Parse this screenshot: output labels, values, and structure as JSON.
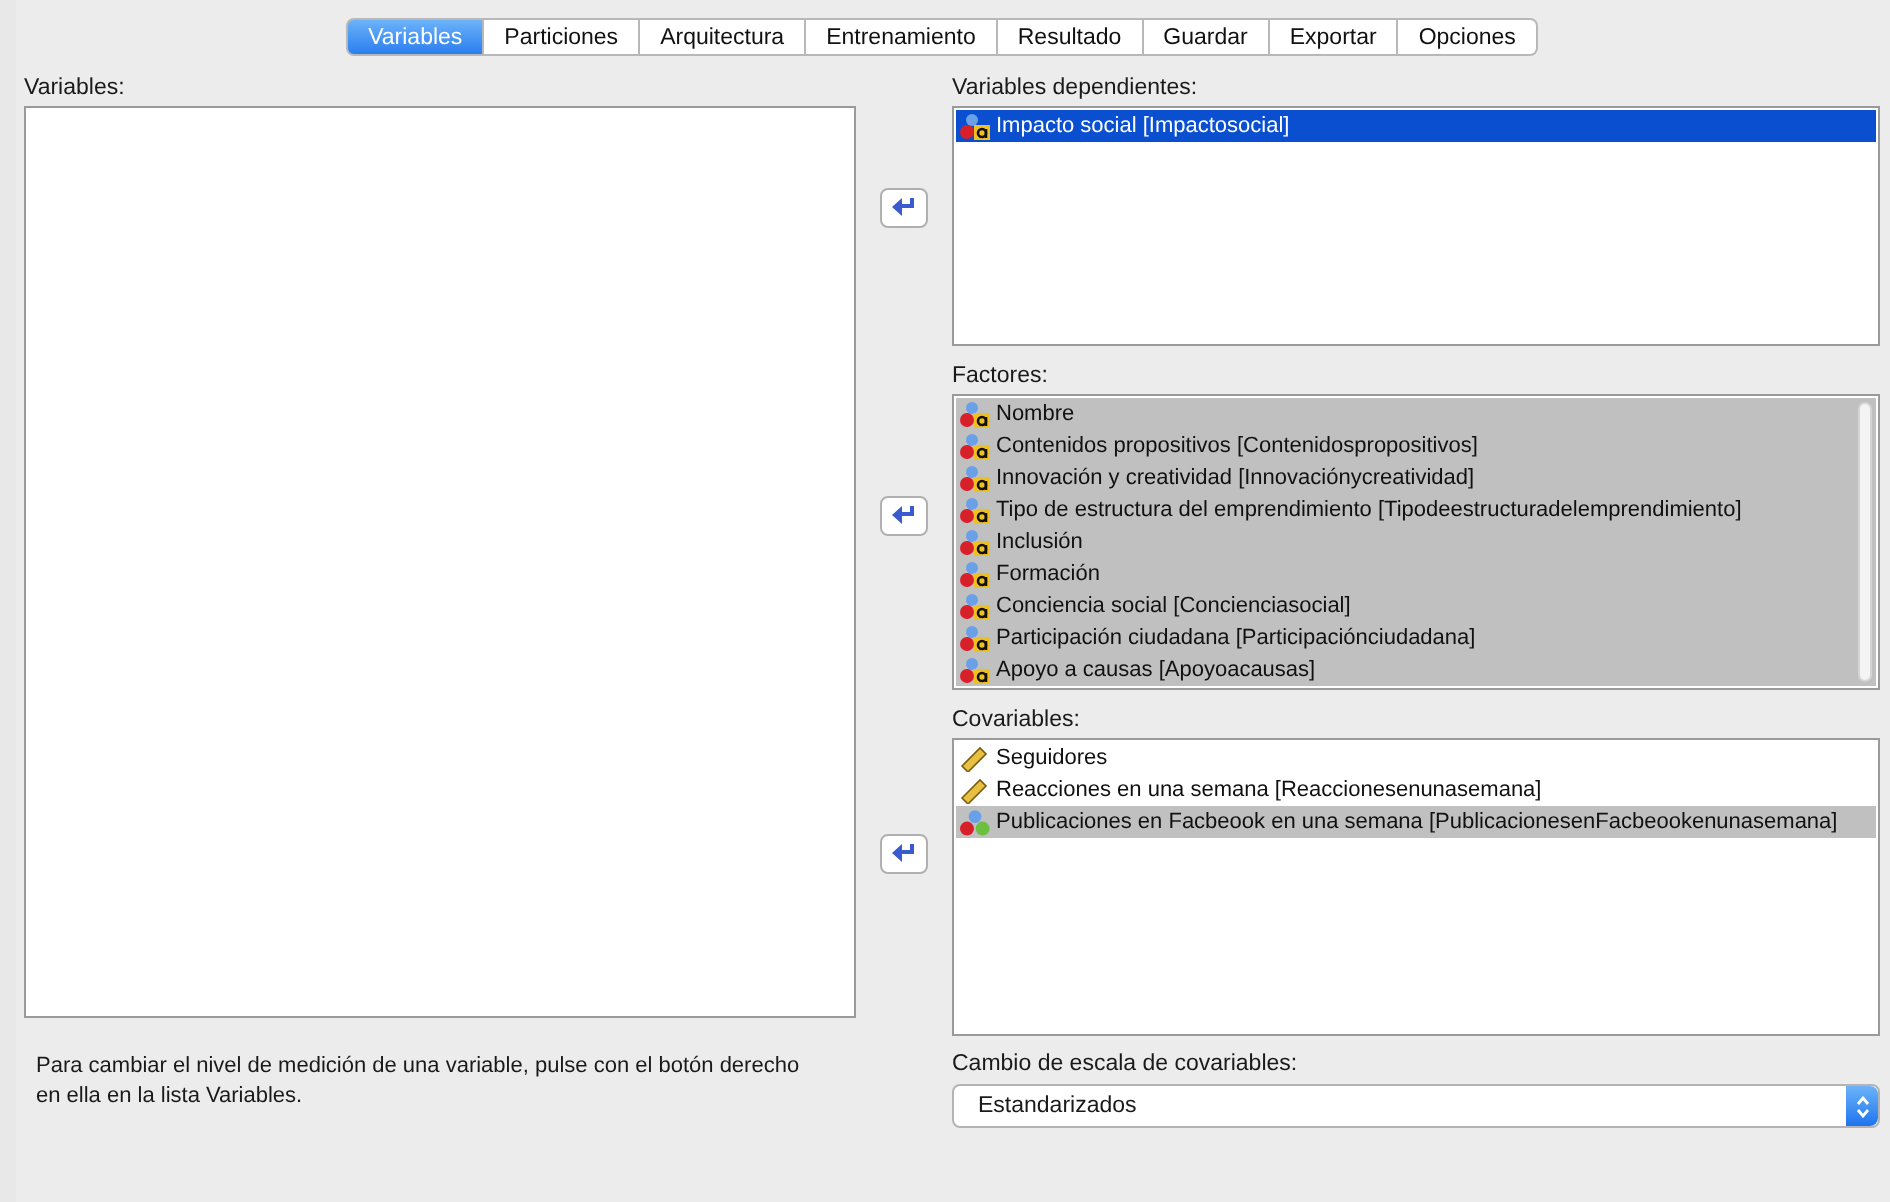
{
  "tabs": [
    {
      "label": "Variables",
      "selected": true
    },
    {
      "label": "Particiones",
      "selected": false
    },
    {
      "label": "Arquitectura",
      "selected": false
    },
    {
      "label": "Entrenamiento",
      "selected": false
    },
    {
      "label": "Resultado",
      "selected": false
    },
    {
      "label": "Guardar",
      "selected": false
    },
    {
      "label": "Exportar",
      "selected": false
    },
    {
      "label": "Opciones",
      "selected": false
    }
  ],
  "variables": {
    "label": "Variables:"
  },
  "dependent": {
    "label": "Variables dependientes:",
    "focused": true,
    "items": [
      {
        "kind": "nominal-string",
        "text": "Impacto social [Impactosocial]",
        "selected": true
      }
    ]
  },
  "factors": {
    "label": "Factores:",
    "focused": false,
    "items": [
      {
        "kind": "nominal-string",
        "text": "Nombre",
        "selected": true
      },
      {
        "kind": "nominal-string",
        "text": "Contenidos propositivos [Contenidospropositivos]",
        "selected": true
      },
      {
        "kind": "nominal-string",
        "text": "Innovación y creatividad [Innovaciónycreatividad]",
        "selected": true
      },
      {
        "kind": "nominal-string",
        "text": "Tipo de estructura del emprendimiento [Tipodeestructuradelemprendimiento]",
        "selected": true
      },
      {
        "kind": "nominal-string",
        "text": "Inclusión",
        "selected": true
      },
      {
        "kind": "nominal-string",
        "text": "Formación",
        "selected": true
      },
      {
        "kind": "nominal-string",
        "text": "Conciencia social [Concienciasocial]",
        "selected": true
      },
      {
        "kind": "nominal-string",
        "text": "Participación ciudadana [Participaciónciudadana]",
        "selected": true
      },
      {
        "kind": "nominal-string",
        "text": "Apoyo a causas [Apoyoacausas]",
        "selected": true
      }
    ]
  },
  "covariates": {
    "label": "Covariables:",
    "focused": false,
    "items": [
      {
        "kind": "scale",
        "text": "Seguidores",
        "selected": false
      },
      {
        "kind": "scale",
        "text": "Reacciones en una semana [Reaccionesenunasemana]",
        "selected": false
      },
      {
        "kind": "nominal",
        "text": "Publicaciones en Facbeook en una semana [PublicacionesenFacbeookenunasemana]",
        "selected": true
      }
    ]
  },
  "hint": "Para cambiar el nivel de medición de una variable, pulse con el botón derecho en ella en la lista Variables.",
  "rescale": {
    "label": "Cambio de escala de covariables:",
    "value": "Estandarizados"
  }
}
